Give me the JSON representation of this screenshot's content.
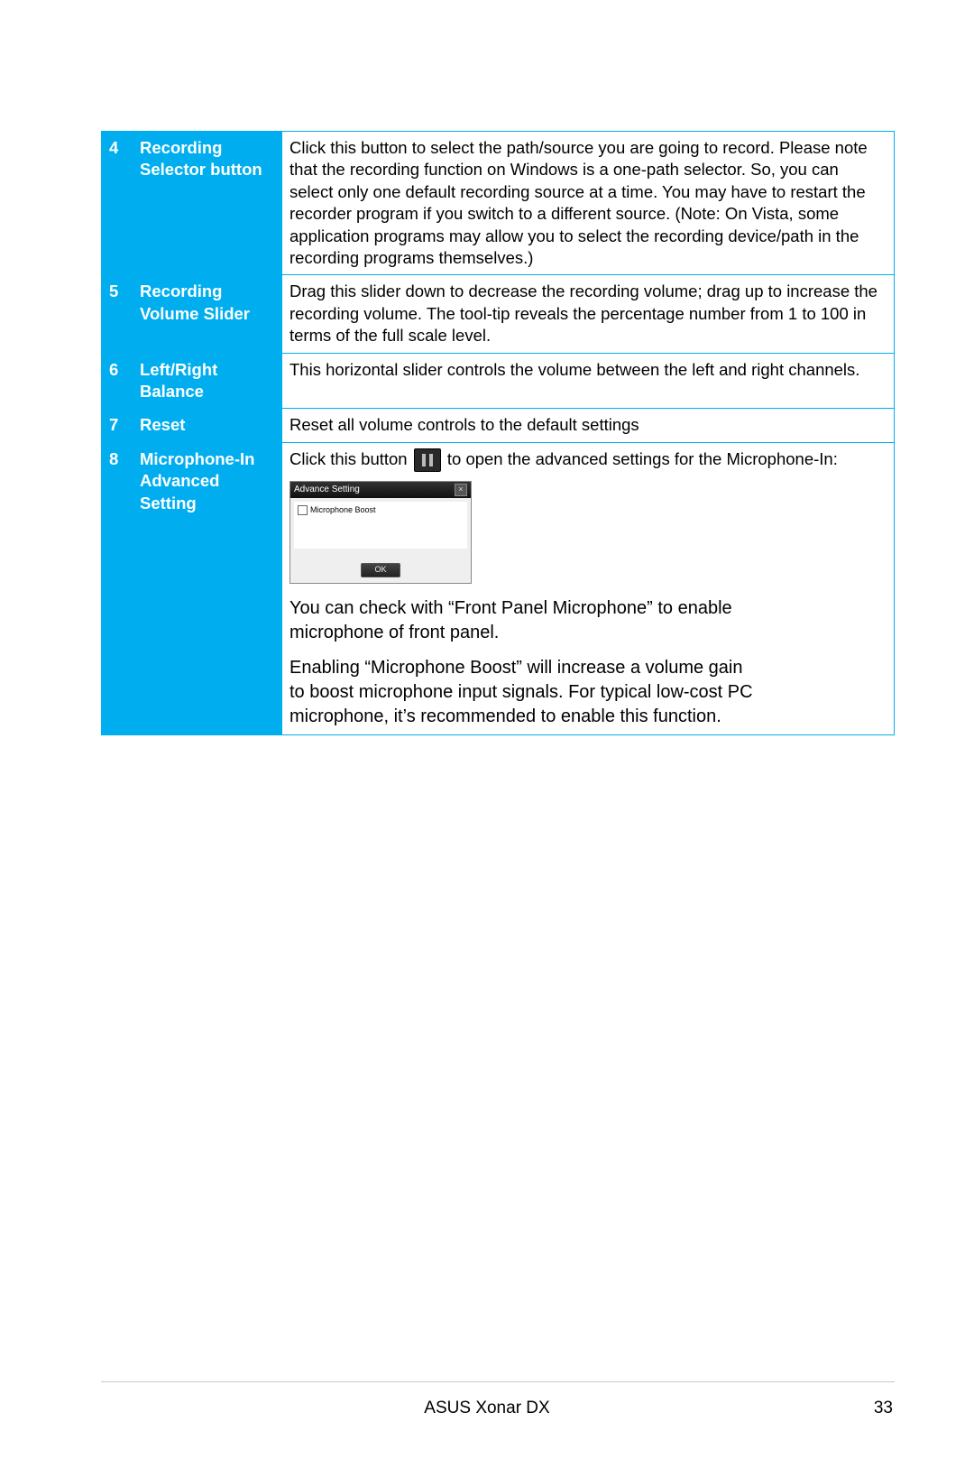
{
  "rows": [
    {
      "num": "4",
      "label": "Recording Selector button",
      "desc": "Click this button to select the path/source you are going to record. Please note that the recording function on Windows is a one-path selector. So, you can select only one default recording source at a time. You may have to restart the recorder program if you switch to a different source. (Note: On Vista, some application programs may allow you to select the recording device/path in the recording programs themselves.)"
    },
    {
      "num": "5",
      "label": "Recording Volume Slider",
      "desc": "Drag this slider down to decrease the recording volume; drag up to increase the recording volume. The tool-tip reveals the percentage number from 1 to 100 in terms of the full scale level."
    },
    {
      "num": "6",
      "label": "Left/Right Balance",
      "desc": "This horizontal slider controls the volume between the left and right channels."
    },
    {
      "num": "7",
      "label": "Reset",
      "desc": "Reset all volume controls to the default settings"
    }
  ],
  "row8": {
    "num": "8",
    "label": "Microphone-In Advanced Setting",
    "pre": "Click this button ",
    "post": " to open the advanced settings for the Microphone-In:",
    "dialog_title": "Advance Setting",
    "dialog_checkbox": "Microphone Boost",
    "dialog_ok": "OK",
    "p1": "You can check with “Front Panel Microphone” to enable microphone of front panel.",
    "p2": "Enabling “Microphone Boost” will increase a volume gain to boost microphone input signals. For typical low-cost PC microphone, it’s recommended to  enable this function."
  },
  "footer": {
    "product": "ASUS Xonar DX",
    "page": "33"
  }
}
